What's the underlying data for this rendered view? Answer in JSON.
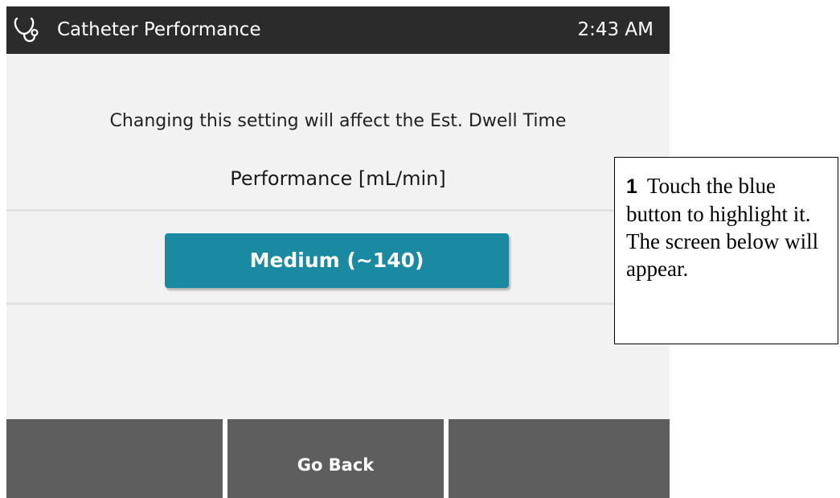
{
  "header": {
    "icon": "stethoscope-icon",
    "title": "Catheter Performance",
    "time": "2:43 AM"
  },
  "main": {
    "warning": "Changing this setting will affect the Est. Dwell Time",
    "heading": "Performance [mL/min]",
    "value_button_label": "Medium (~140)"
  },
  "footer": {
    "left_label": "",
    "center_label": "Go Back",
    "right_label": ""
  },
  "callout": {
    "step": "1",
    "text": "Touch the blue button to highlight it. The screen below will appear."
  },
  "colors": {
    "titlebar": "#2b2b2b",
    "accent": "#1a8aa3",
    "softkey": "#5e5e5e",
    "background": "#f2f2f2"
  }
}
